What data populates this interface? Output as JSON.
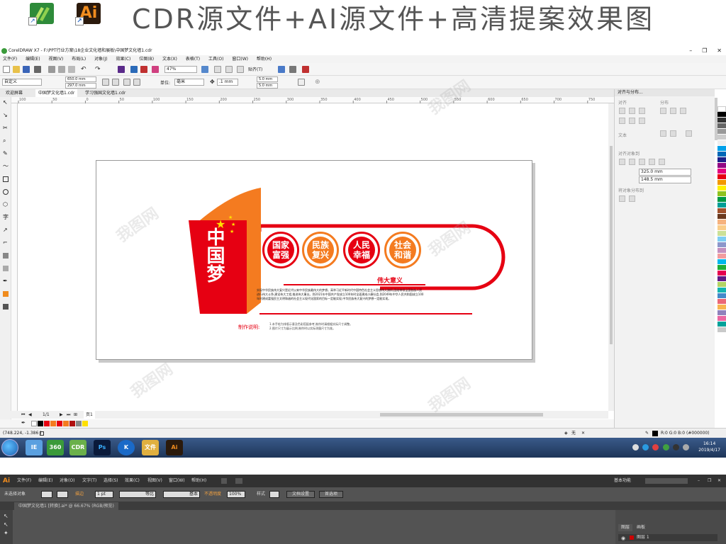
{
  "banner": {
    "title": "CDR源文件+AI源文件+高清提案效果图",
    "cdr_icon": "coreldraw-icon",
    "ai_icon_label": "Ai"
  },
  "cdr": {
    "window_title": "CorelDRAW X7 - F:\\PPT行业方案\\18企业文化墙和展板\\中国梦文化墙1.cdr",
    "menu": [
      "文件(F)",
      "编辑(E)",
      "视图(V)",
      "布局(L)",
      "对象(J)",
      "效果(C)",
      "位图(B)",
      "文本(X)",
      "表格(T)",
      "工具(O)",
      "窗口(W)",
      "帮助(H)"
    ],
    "toolbar": {
      "zoom": "47%",
      "snap_label": "贴齐(T)",
      "preset": "自定义",
      "width": "650.0 mm",
      "height": "297.0 mm",
      "units_label": "单位:",
      "units": "毫米",
      "nudge": ".1 mm",
      "dup_x": "5.0 mm",
      "dup_y": "5.0 mm"
    },
    "tabs": [
      "欢迎屏幕",
      "中国梦文化墙1.cdr",
      "学习强国文化墙1.cdr"
    ],
    "ruler_ticks": [
      "100",
      "50",
      "0",
      "50",
      "100",
      "150",
      "200",
      "250",
      "300",
      "350",
      "400",
      "450",
      "500",
      "550",
      "600",
      "650",
      "700",
      "750"
    ],
    "page_nav": "1/1",
    "page_tab": "页1",
    "status_coords": "(748.224, -1.386 )",
    "fill_status": "R:0 G:0 B:0 (#000000)",
    "none_label": "无"
  },
  "dock": {
    "title": "对齐与分布...",
    "align_label": "对齐",
    "distribute_label": "分布",
    "text_label": "文本",
    "align_objects_label": "对齐对象到",
    "x_value": "325.0 mm",
    "y_value": "148.5 mm",
    "distribute_to_label": "将对象分布到"
  },
  "design": {
    "dream_title": "中国梦",
    "badges": [
      {
        "line1": "国家",
        "line2": "富强",
        "color": "#e60012"
      },
      {
        "line1": "民族",
        "line2": "复兴",
        "color": "#f47b20"
      },
      {
        "line1": "人民",
        "line2": "幸福",
        "color": "#e60012"
      },
      {
        "line1": "社会",
        "line2": "和谐",
        "color": "#f47b20"
      }
    ],
    "section_title": "伟大意义",
    "body_text": "实现中华民族伟大复兴是近代以来中华民族最伟大的梦想。高举习近平新时代中国特色社会主义思想伟大旗帜,团结带领全国各族人民进行伟大斗争,建设伟大工程,推进伟大事业。到2021年中国共产党成立100年时全面建成小康社会,到2049年中华人民共和国成立100年时建成富强民主文明和谐的社会主义现代化国家的目标一定能实现,中华民族伟大复兴的梦想一定能实现。",
    "note_label": "制作说明:",
    "note_lines": [
      "1.本手绘为排版示意及色彩搭配参考,制作时请根据实际尺寸调整。",
      "2.图片尺寸为展示比例,制作时以实际测量尺寸为准。"
    ],
    "red": "#e60012",
    "orange": "#f47b20",
    "star": "#ffe000"
  },
  "taskbar": {
    "time": "16:14",
    "date": "2019/4/17",
    "apps": [
      "IE",
      "360",
      "CDR",
      "Ps",
      "K",
      "文件",
      "Ai"
    ]
  },
  "ai": {
    "menu": [
      "文件(F)",
      "编辑(E)",
      "对象(O)",
      "文字(T)",
      "选择(S)",
      "效果(C)",
      "视图(V)",
      "窗口(W)",
      "帮助(H)"
    ],
    "workspace": "基本功能",
    "control": {
      "no_selection": "未选择对象",
      "stroke_label": "描边",
      "stroke_value": "1 pt",
      "uniform": "等比",
      "basic": "基本",
      "opacity_label": "不透明度",
      "opacity_value": "100%",
      "style_label": "样式",
      "doc_setup": "文档设置",
      "prefs": "首选项"
    },
    "doc_tab": "中国梦文化墙1 [转换].ai* @ 66.67% (RGB/预览)",
    "layers_tab": "图层",
    "artboards_tab": "画板",
    "layer_name": "图层 1"
  },
  "watermark": "我图网"
}
